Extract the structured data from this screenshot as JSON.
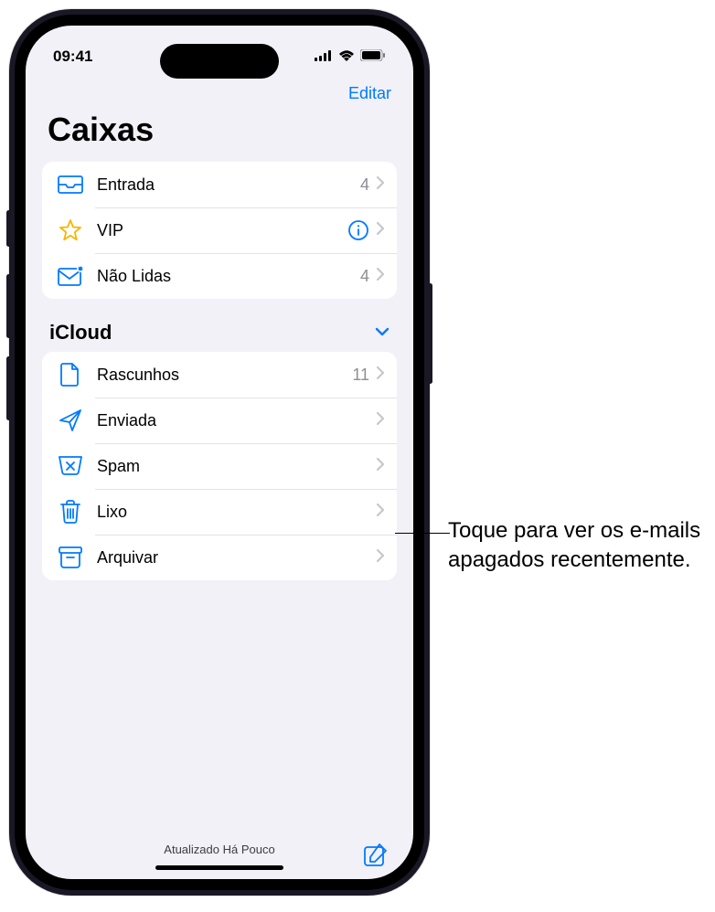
{
  "status_bar": {
    "time": "09:41"
  },
  "nav": {
    "edit": "Editar"
  },
  "title": "Caixas",
  "mailboxes": [
    {
      "icon": "inbox",
      "label": "Entrada",
      "count": "4",
      "info": false
    },
    {
      "icon": "star",
      "label": "VIP",
      "count": "",
      "info": true
    },
    {
      "icon": "unread",
      "label": "Não Lidas",
      "count": "4",
      "info": false
    }
  ],
  "section": {
    "title": "iCloud"
  },
  "icloud_folders": [
    {
      "icon": "doc",
      "label": "Rascunhos",
      "count": "11"
    },
    {
      "icon": "sent",
      "label": "Enviada",
      "count": ""
    },
    {
      "icon": "spam",
      "label": "Spam",
      "count": ""
    },
    {
      "icon": "trash",
      "label": "Lixo",
      "count": ""
    },
    {
      "icon": "archive",
      "label": "Arquivar",
      "count": ""
    }
  ],
  "footer": {
    "status": "Atualizado Há Pouco"
  },
  "callout": {
    "text": "Toque para ver os e-mails apagados recentemente."
  }
}
